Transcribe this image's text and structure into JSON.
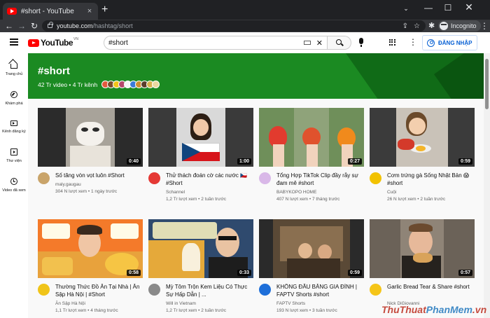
{
  "browser": {
    "tab_title": "#short - YouTube",
    "tab_close": "×",
    "new_tab": "+",
    "url_host": "youtube.com",
    "url_path": "/hashtag/short",
    "incognito_label": "Incognito",
    "window": {
      "dropdown": "⌄",
      "minimize": "—",
      "maximize": "☐",
      "close": "✕"
    },
    "nav": {
      "back": "←",
      "forward": "→",
      "reload": "↻",
      "menu": "⋮",
      "share": "⇪",
      "bookmark": "☆",
      "extensions": "✱"
    }
  },
  "masthead": {
    "logo_text": "YouTube",
    "logo_region": "VN",
    "search_value": "#short",
    "clear": "✕",
    "kebab": "⋮",
    "signin_label": "ĐĂNG NHẬP"
  },
  "guide": [
    {
      "label": "Trang chủ",
      "icon": "home-icon"
    },
    {
      "label": "Khám phá",
      "icon": "compass-icon"
    },
    {
      "label": "Kênh đăng ký",
      "icon": "subscriptions-icon"
    },
    {
      "label": "Thư viện",
      "icon": "library-icon"
    },
    {
      "label": "Video đã xem",
      "icon": "history-icon"
    }
  ],
  "banner": {
    "hashtag": "#short",
    "stats": "42 Tr video • 4 Tr kênh",
    "avatar_colors": [
      "#e2593d",
      "#7a4b2a",
      "#f0c419",
      "#b5486b",
      "#f5f5f5",
      "#3b7bd8",
      "#cf8f32",
      "#5a3d2b",
      "#d7b14e",
      "#e8d8a0"
    ]
  },
  "videos": [
    {
      "title": "Số tăng vòn vọt luôn #Short",
      "channel": "maly.gaugau",
      "stats": "304 N lượt xem • 1 ngày trước",
      "duration": "0:40",
      "avatar": "#c9a46a"
    },
    {
      "title": "Thử thách đoán cờ các nước 🇨🇿 #Short",
      "channel": "Schannel",
      "stats": "1,2 Tr lượt xem • 2 tuần trước",
      "duration": "1:00",
      "avatar": "#e53935"
    },
    {
      "title": "Tổng Hợp TikTok Clip đầy rẫy sự đam mê #short",
      "channel": "BABYKOPO HOME",
      "stats": "407 N lượt xem • 7 tháng trước",
      "duration": "0:27",
      "avatar": "#d9b8e8"
    },
    {
      "title": "Cơm trứng gà Sống Nhật Bản 😱 #short",
      "channel": "Cuội",
      "stats": "26 N lượt xem • 2 tuần trước",
      "duration": "0:59",
      "avatar": "#f2c200"
    },
    {
      "title": "Thường Thức Đồ Ăn Tại Nhà | Ăn Sập Hà Nội | #Short",
      "channel": "Ăn Sập Hà Nội",
      "stats": "1,1 Tr lượt xem • 4 tháng trước",
      "duration": "0:58",
      "avatar": "#f0c419"
    },
    {
      "title": "Mỳ Tôm Trộn Kem Liệu Có Thực Sự Hấp Dẫn | ...",
      "channel": "Will in Vietnam",
      "stats": "1,2 Tr lượt xem • 2 tuần trước",
      "duration": "0:33",
      "avatar": "#8a8a8a"
    },
    {
      "title": "KHÔNG ĐẦU BĂNG GIA ĐÌNH | FAPTV Shorts #short",
      "channel": "FAPTV Shorts",
      "stats": "193 N lượt xem • 3 tuần trước",
      "duration": "0:59",
      "avatar": "#1e6fd9"
    },
    {
      "title": "Garlic Bread Tear & Share #short",
      "channel": "Nick DiGiovanni",
      "stats": "",
      "duration": "0:57",
      "avatar": "#f5c518"
    }
  ],
  "watermark": {
    "part1": "ThuThuat",
    "part2": "PhanMem",
    "part3": ".vn"
  },
  "colors": {
    "banner_green": "#1b8a22",
    "brand_red": "#ff0000",
    "signin_blue": "#065fd4"
  }
}
